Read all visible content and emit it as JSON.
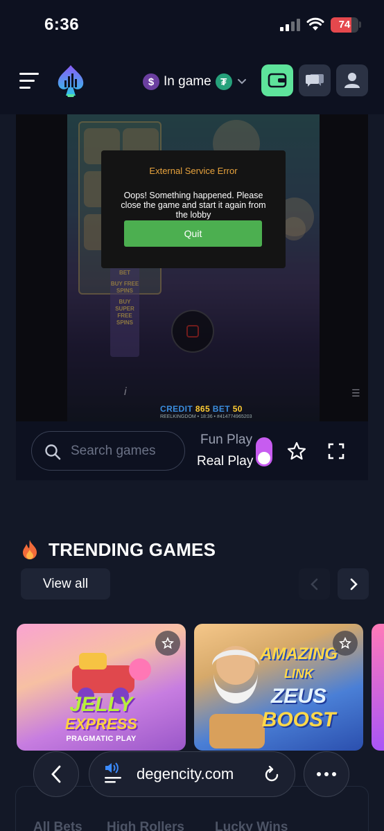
{
  "status_bar": {
    "time": "6:36",
    "battery_level": "74",
    "battery_fraction": 0.74
  },
  "header": {
    "balance_label": "In game",
    "currency_symbol": "$",
    "token_symbol": "₮"
  },
  "game": {
    "credit_label": "CREDIT",
    "credit_value": "865",
    "bet_label": "BET",
    "bet_value": "50",
    "footer_text": "REELKINGDOM • 18:36 • #414774965203",
    "side_buttons": [
      "BET",
      "BUY FREE SPINS",
      "BUY SUPER FREE SPINS"
    ]
  },
  "error_dialog": {
    "title": "External Service Error",
    "message": "Oops! Something happened. Please close the game and start it again from the lobby",
    "quit_label": "Quit"
  },
  "controls": {
    "search_placeholder": "Search games",
    "fun_play_label": "Fun Play",
    "real_play_label": "Real Play"
  },
  "trending": {
    "title": "TRENDING GAMES",
    "view_all_label": "View all",
    "games": [
      {
        "title_line1": "JELLY",
        "title_line2": "EXPRESS",
        "provider": "PRAGMATIC PLAY"
      },
      {
        "title_line1": "AMAZING",
        "title_line2": "LINK",
        "title_line3": "ZEUS",
        "title_line4": "BOOST"
      }
    ]
  },
  "browser": {
    "url": "degencity.com"
  },
  "bottom_tabs": [
    "All Bets",
    "High Rollers",
    "Lucky Wins"
  ],
  "colors": {
    "background": "#131827",
    "header_bg": "#0d1120",
    "wallet_accent": "#5ee39b",
    "toggle_accent": "#c75cf0",
    "quit_button": "#4caf50",
    "error_title": "#e8a33d"
  }
}
